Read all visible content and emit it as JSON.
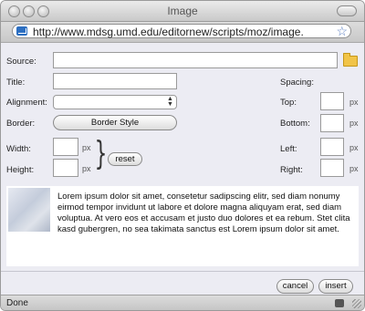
{
  "window": {
    "title": "Image"
  },
  "browser": {
    "url": "http://www.mdsg.umd.edu/editornew/scripts/moz/image.",
    "icons": {
      "site": "site-favicon",
      "bookmark": "star-icon"
    }
  },
  "form": {
    "source_label": "Source:",
    "source_value": "",
    "title_label": "Title:",
    "title_value": "",
    "alignment_label": "Alignment:",
    "alignment_value": "",
    "border_label": "Border:",
    "border_button": "Border Style",
    "width_label": "Width:",
    "width_value": "",
    "height_label": "Height:",
    "height_value": "",
    "px_unit": "px",
    "reset_button": "reset",
    "spacing_label": "Spacing:",
    "top_label": "Top:",
    "bottom_label": "Bottom:",
    "left_label": "Left:",
    "right_label": "Right:",
    "top_value": "",
    "bottom_value": "",
    "left_value": "",
    "right_value": "",
    "browse_icon": "folder-icon"
  },
  "preview": {
    "text": "Lorem ipsum dolor sit amet, consetetur sadipscing elitr, sed diam nonumy eirmod tempor invidunt ut labore et dolore magna aliquyam erat, sed diam voluptua. At vero eos et accusam et justo duo dolores et ea rebum. Stet clita kasd gubergren, no sea takimata sanctus est Lorem ipsum dolor sit amet."
  },
  "actions": {
    "cancel": "cancel",
    "insert": "insert"
  },
  "status": {
    "text": "Done"
  }
}
